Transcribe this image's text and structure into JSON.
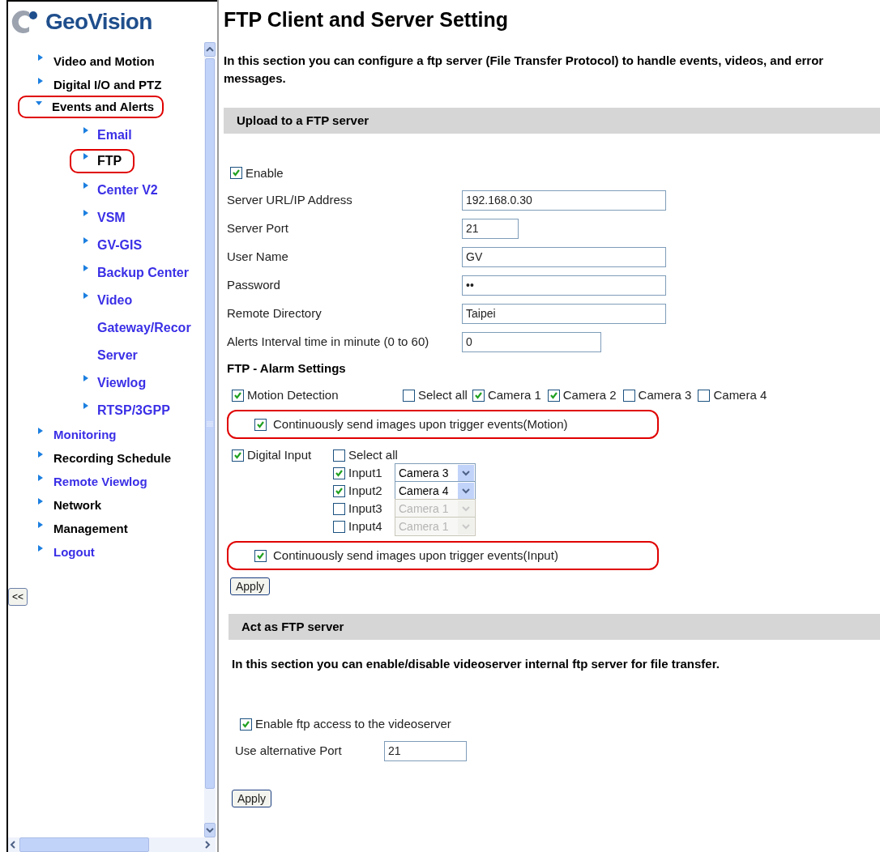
{
  "logo": {
    "text": "GeoVision"
  },
  "sidebar": {
    "items": [
      {
        "label": "Video and Motion",
        "visited": false,
        "expanded": false,
        "highlighted": false
      },
      {
        "label": "Digital I/O and PTZ",
        "visited": false,
        "expanded": false,
        "highlighted": false
      },
      {
        "label": "Events and Alerts",
        "visited": false,
        "expanded": true,
        "highlighted": true,
        "children": [
          {
            "lines": [
              "Email"
            ],
            "visited": true,
            "highlighted": false
          },
          {
            "lines": [
              "FTP"
            ],
            "visited": false,
            "highlighted": true
          },
          {
            "lines": [
              "Center V2"
            ],
            "visited": true,
            "highlighted": false
          },
          {
            "lines": [
              "VSM"
            ],
            "visited": true,
            "highlighted": false
          },
          {
            "lines": [
              "GV-GIS"
            ],
            "visited": true,
            "highlighted": false
          },
          {
            "lines": [
              "Backup Center"
            ],
            "visited": true,
            "highlighted": false
          },
          {
            "lines": [
              "Video",
              "Gateway/Recor",
              "Server"
            ],
            "visited": true,
            "highlighted": false
          },
          {
            "lines": [
              "Viewlog"
            ],
            "visited": true,
            "highlighted": false
          },
          {
            "lines": [
              "RTSP/3GPP"
            ],
            "visited": true,
            "highlighted": false
          }
        ]
      },
      {
        "label": "Monitoring",
        "visited": true,
        "expanded": false,
        "highlighted": false
      },
      {
        "label": "Recording Schedule",
        "visited": false,
        "expanded": false,
        "highlighted": false
      },
      {
        "label": "Remote Viewlog",
        "visited": true,
        "expanded": false,
        "highlighted": false
      },
      {
        "label": "Network",
        "visited": false,
        "expanded": false,
        "highlighted": false
      },
      {
        "label": "Management",
        "visited": false,
        "expanded": false,
        "highlighted": false
      },
      {
        "label": "Logout",
        "visited": true,
        "expanded": false,
        "highlighted": false
      }
    ]
  },
  "collapse_button": "<<",
  "page": {
    "title": "FTP Client and Server Setting",
    "description_lines": [
      "In this section you can configure a ftp server (File Transfer Protocol) to handle events, videos, and error",
      "messages."
    ]
  },
  "upload_section": {
    "header": "Upload to a FTP server",
    "enable": {
      "label": "Enable",
      "checked": true
    },
    "fields": [
      {
        "label": "Server URL/IP Address",
        "value": "192.168.0.30",
        "kind": "long"
      },
      {
        "label": "Server Port",
        "value": "21",
        "kind": "short"
      },
      {
        "label": "User Name",
        "value": "GV",
        "kind": "long"
      },
      {
        "label": "Password",
        "value": "••",
        "kind": "long"
      },
      {
        "label": "Remote Directory",
        "value": "Taipei",
        "kind": "long"
      },
      {
        "label": "Alerts Interval time in minute (0 to 60)",
        "value": "0",
        "kind": "medium"
      }
    ],
    "alarm_title": "FTP - Alarm Settings",
    "motion": {
      "label": "Motion Detection",
      "checked": true,
      "select_all": {
        "label": "Select all",
        "checked": false
      },
      "cameras": [
        {
          "label": "Camera 1",
          "checked": true
        },
        {
          "label": "Camera 2",
          "checked": true
        },
        {
          "label": "Camera 3",
          "checked": false
        },
        {
          "label": "Camera 4",
          "checked": false
        }
      ]
    },
    "motion_continuous": {
      "label": "Continuously send images upon trigger events(Motion)",
      "checked": true,
      "highlighted": true
    },
    "digital_input": {
      "label": "Digital Input",
      "checked": true,
      "select_all": {
        "label": "Select all",
        "checked": false
      },
      "inputs": [
        {
          "label": "Input1",
          "checked": true,
          "camera": "Camera 3",
          "disabled": false
        },
        {
          "label": "Input2",
          "checked": true,
          "camera": "Camera 4",
          "disabled": false
        },
        {
          "label": "Input3",
          "checked": false,
          "camera": "Camera 1",
          "disabled": true
        },
        {
          "label": "Input4",
          "checked": false,
          "camera": "Camera 1",
          "disabled": true
        }
      ]
    },
    "input_continuous": {
      "label": "Continuously send images upon trigger events(Input)",
      "checked": true,
      "highlighted": true
    },
    "apply": "Apply"
  },
  "server_section": {
    "header": "Act as FTP server",
    "description": "In this section you can enable/disable videoserver internal ftp server for file transfer.",
    "enable": {
      "label": "Enable ftp access to the videoserver",
      "checked": true
    },
    "port": {
      "label": "Use alternative Port",
      "value": "21"
    },
    "apply": "Apply"
  }
}
